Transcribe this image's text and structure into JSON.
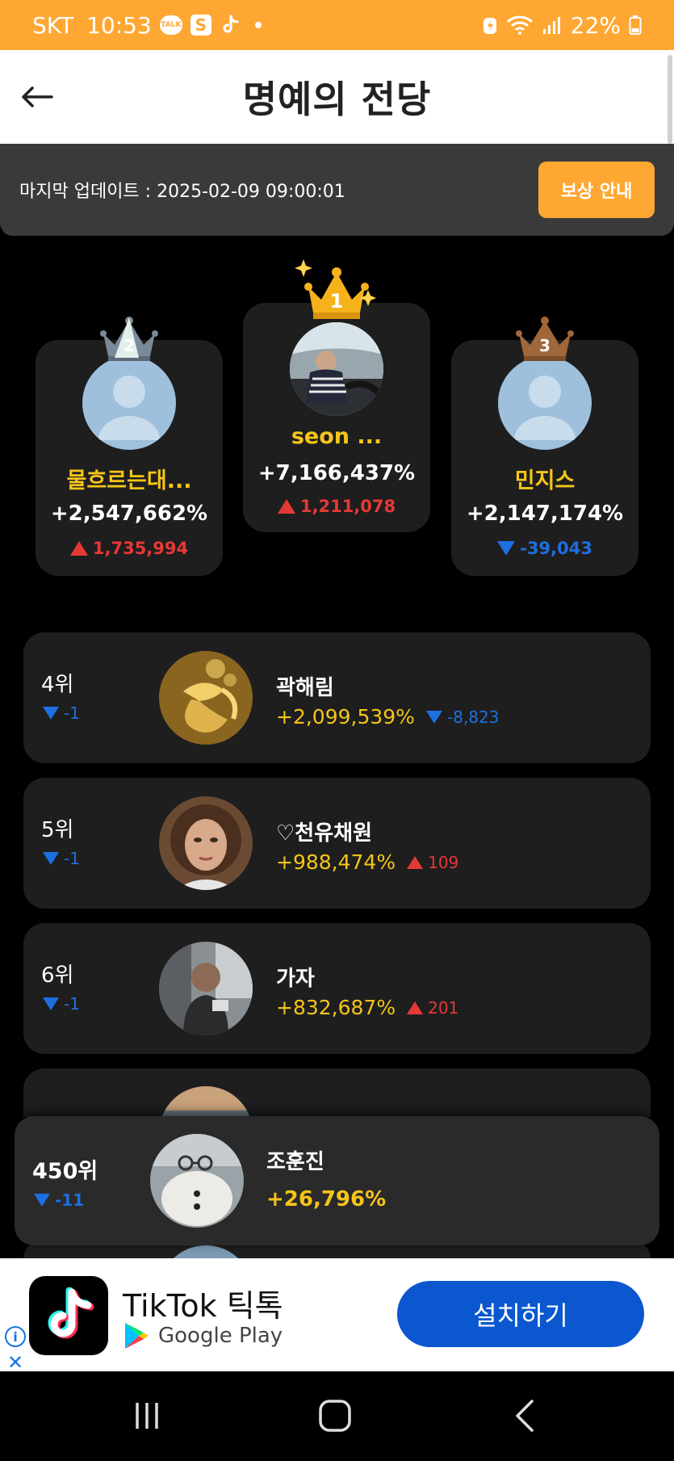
{
  "status_bar": {
    "carrier": "SKT",
    "time": "10:53",
    "talk_badge": "TALK",
    "battery": "22%"
  },
  "header": {
    "title": "명예의 전당"
  },
  "update": {
    "text": "마지막 업데이트 : 2025-02-09 09:00:01",
    "reward_button": "보상 안내"
  },
  "podium": [
    {
      "rank": "1",
      "name": "seon ...",
      "percent": "+7,166,437%",
      "change": "1,211,078",
      "direction": "up",
      "crown_color": "#F6B21A"
    },
    {
      "rank": "2",
      "name": "물흐르는대...",
      "percent": "+2,547,662%",
      "change": "1,735,994",
      "direction": "up",
      "crown_color": "#7B8A99"
    },
    {
      "rank": "3",
      "name": "민지스",
      "percent": "+2,147,174%",
      "change": "-39,043",
      "direction": "down",
      "crown_color": "#A0673A"
    }
  ],
  "ranks": [
    {
      "rank_label": "4위",
      "delta": "-1",
      "delta_dir": "down",
      "name": "곽해림",
      "percent": "+2,099,539%",
      "change": "-8,823",
      "direction": "down"
    },
    {
      "rank_label": "5위",
      "delta": "-1",
      "delta_dir": "down",
      "name": "♡천유채원",
      "percent": "+988,474%",
      "change": "109",
      "direction": "up"
    },
    {
      "rank_label": "6위",
      "delta": "-1",
      "delta_dir": "down",
      "name": "가자",
      "percent": "+832,687%",
      "change": "201",
      "direction": "up"
    }
  ],
  "my_rank": {
    "rank_label": "450위",
    "delta": "-11",
    "delta_dir": "down",
    "name": "조훈진",
    "percent": "+26,796%"
  },
  "ad": {
    "title": "TikTok 틱톡",
    "store": "Google Play",
    "install": "설치하기"
  },
  "colors": {
    "accent": "#FFA733",
    "gold_text": "#F5C518",
    "up": "#e53935",
    "down": "#1e6fe0",
    "install": "#0B57D0"
  }
}
